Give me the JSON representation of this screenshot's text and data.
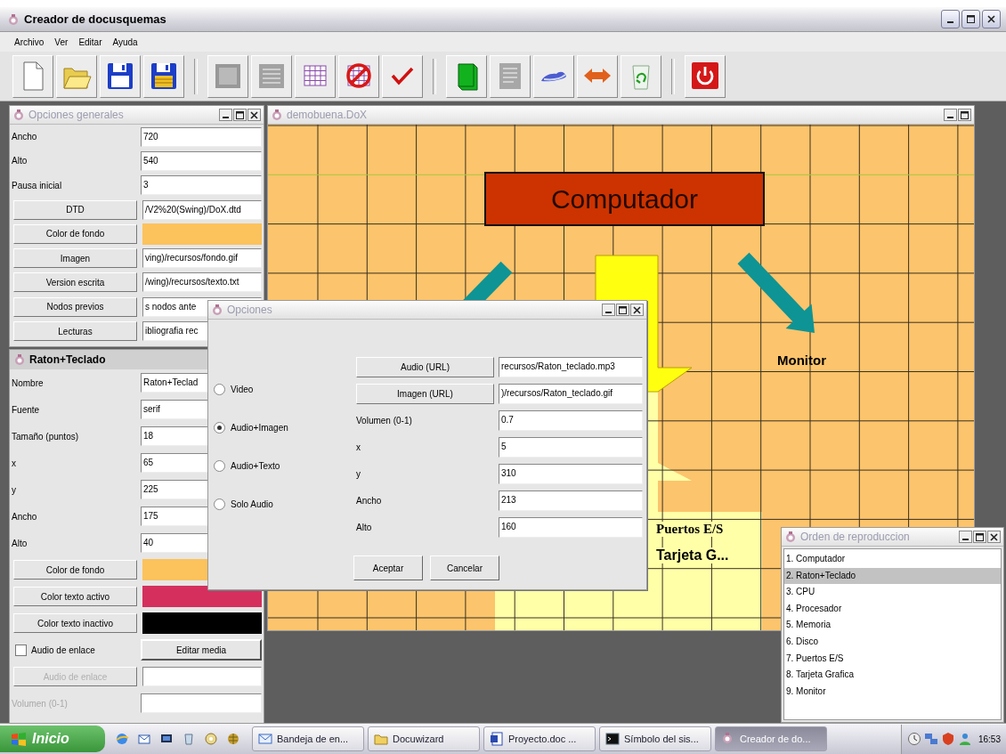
{
  "window": {
    "title": "Creador de docusquemas"
  },
  "menu": [
    "Archivo",
    "Ver",
    "Editar",
    "Ayuda"
  ],
  "toolbar": [
    [
      {
        "kind": "new",
        "disabled": false
      },
      {
        "kind": "open",
        "disabled": false
      },
      {
        "kind": "save",
        "disabled": false
      },
      {
        "kind": "saveas",
        "disabled": false
      }
    ],
    [
      {
        "kind": "panel",
        "disabled": true
      },
      {
        "kind": "list",
        "disabled": true
      },
      {
        "kind": "grid",
        "disabled": false
      },
      {
        "kind": "forbid",
        "disabled": false
      },
      {
        "kind": "check",
        "disabled": false
      }
    ],
    [
      {
        "kind": "book",
        "disabled": false
      },
      {
        "kind": "doc",
        "disabled": true
      },
      {
        "kind": "cloud",
        "disabled": false
      },
      {
        "kind": "swap",
        "disabled": false
      },
      {
        "kind": "recycle",
        "disabled": false
      }
    ],
    [
      {
        "kind": "power",
        "disabled": false
      }
    ]
  ],
  "general_options": {
    "title": "Opciones generales",
    "rows": [
      {
        "kind": "field",
        "label": "Ancho",
        "value": "720"
      },
      {
        "kind": "field",
        "label": "Alto",
        "value": "540"
      },
      {
        "kind": "field",
        "label": "Pausa inicial",
        "value": "3"
      },
      {
        "kind": "button",
        "label": "DTD",
        "value": "/V2%20(Swing)/DoX.dtd"
      },
      {
        "kind": "color",
        "label": "Color de fondo",
        "color": "#fcc25c"
      },
      {
        "kind": "button",
        "label": "Imagen",
        "value": "ving)/recursos/fondo.gif"
      },
      {
        "kind": "button",
        "label": "Version escrita",
        "value": "/wing)/recursos/texto.txt"
      },
      {
        "kind": "button",
        "label": "Nodos previos",
        "value": "s nodos ante"
      },
      {
        "kind": "button",
        "label": "Lecturas",
        "value": "ibliografia rec"
      }
    ]
  },
  "node_panel": {
    "title": "Raton+Teclado",
    "rows": [
      {
        "kind": "field",
        "label": "Nombre",
        "value": "Raton+Teclad",
        "disabled": false
      },
      {
        "kind": "field",
        "label": "Fuente",
        "value": "serif",
        "disabled": false
      },
      {
        "kind": "field",
        "label": "Tamaño (puntos)",
        "value": "18",
        "disabled": false
      },
      {
        "kind": "field",
        "label": "x",
        "value": "65",
        "disabled": false
      },
      {
        "kind": "field",
        "label": "y",
        "value": "225",
        "disabled": false
      },
      {
        "kind": "field",
        "label": "Ancho",
        "value": "175",
        "disabled": false
      },
      {
        "kind": "field",
        "label": "Alto",
        "value": "40",
        "disabled": false
      },
      {
        "kind": "color",
        "label": "Color de fondo",
        "color": "#fcc25c",
        "disabled": false
      },
      {
        "kind": "color",
        "label": "Color texto activo",
        "color": "#d52f5e",
        "disabled": false
      },
      {
        "kind": "color",
        "label": "Color texto inactivo",
        "color": "#000000",
        "disabled": false
      },
      {
        "kind": "checkbox",
        "label": "Audio de enlace",
        "checked": false,
        "button": "Editar media",
        "disabled": false
      },
      {
        "kind": "button",
        "label": "Audio de enlace",
        "disabled": true
      },
      {
        "kind": "field",
        "label": "Volumen (0-1)",
        "disabled": true
      }
    ]
  },
  "diagram": {
    "title": "demobuena.DoX",
    "nodes": [
      {
        "kind": "box",
        "lines": [
          "Computador"
        ]
      },
      {
        "kind": "text",
        "lines": [
          "Monitor"
        ]
      },
      {
        "kind": "callout",
        "lines": [
          "Puertos E/S",
          "Tarjeta G..."
        ]
      }
    ]
  },
  "dialog": {
    "title": "Opciones",
    "media_types": [
      {
        "label": "Video",
        "selected": false
      },
      {
        "label": "Audio+Imagen",
        "selected": true
      },
      {
        "label": "Audio+Texto",
        "selected": false
      },
      {
        "label": "Solo Audio",
        "selected": false
      }
    ],
    "rows": [
      {
        "kind": "button",
        "label": "Audio (URL)",
        "value": "recursos/Raton_teclado.mp3"
      },
      {
        "kind": "button",
        "label": "Imagen (URL)",
        "value": ")/recursos/Raton_teclado.gif"
      },
      {
        "kind": "field",
        "label": "Volumen (0-1)",
        "value": "0.7"
      },
      {
        "kind": "field",
        "label": "x",
        "value": "5"
      },
      {
        "kind": "field",
        "label": "y",
        "value": "310"
      },
      {
        "kind": "field",
        "label": "Ancho",
        "value": "213"
      },
      {
        "kind": "field",
        "label": "Alto",
        "value": "160"
      }
    ],
    "buttons": [
      "Aceptar",
      "Cancelar"
    ]
  },
  "playback_order": {
    "title": "Orden de reproduccion",
    "items": [
      {
        "label": "1. Computador",
        "selected": false
      },
      {
        "label": "2. Raton+Teclado",
        "selected": true
      },
      {
        "label": "3. CPU",
        "selected": false
      },
      {
        "label": "4. Procesador",
        "selected": false
      },
      {
        "label": "5. Memoria",
        "selected": false
      },
      {
        "label": "6. Disco",
        "selected": false
      },
      {
        "label": "7. Puertos E/S",
        "selected": false
      },
      {
        "label": "8. Tarjeta Grafica",
        "selected": false
      },
      {
        "label": "9. Monitor",
        "selected": false
      }
    ]
  },
  "taskbar": {
    "start": "Inicio",
    "tasks": [
      {
        "kind": "mail",
        "label": "Bandeja de en...",
        "selected": false
      },
      {
        "kind": "folder",
        "label": "Docuwizard",
        "selected": false
      },
      {
        "kind": "word",
        "label": "Proyecto.doc ...",
        "selected": false
      },
      {
        "kind": "console",
        "label": "Símbolo del sis...",
        "selected": false
      },
      {
        "kind": "app",
        "label": "Creador de do...",
        "selected": true
      }
    ],
    "clock": "16:53"
  }
}
